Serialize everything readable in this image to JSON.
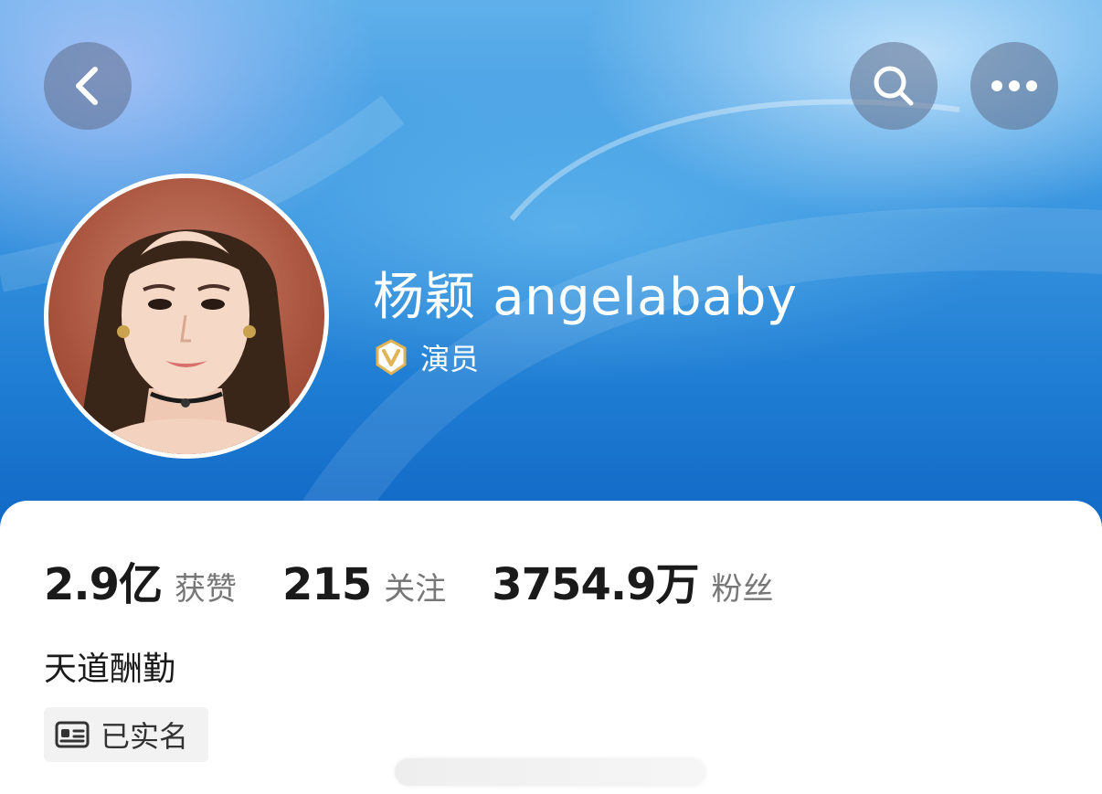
{
  "header": {
    "back_icon": "chevron-left-icon",
    "search_icon": "search-icon",
    "more_icon": "more-dots-icon"
  },
  "profile": {
    "name": "杨颖 angelababy",
    "role": "演员",
    "badge_icon": "verified-v-badge-icon"
  },
  "stats": [
    {
      "value": "2.9亿",
      "label": "获赞"
    },
    {
      "value": "215",
      "label": "关注"
    },
    {
      "value": "3754.9万",
      "label": "粉丝"
    }
  ],
  "bio": "天道酬勤",
  "verification": {
    "icon": "id-card-icon",
    "label": "已实名"
  },
  "colors": {
    "hero_top": "#5fb0ea",
    "hero_bottom": "#0f66c4",
    "badge_gold": "#e0b454"
  }
}
